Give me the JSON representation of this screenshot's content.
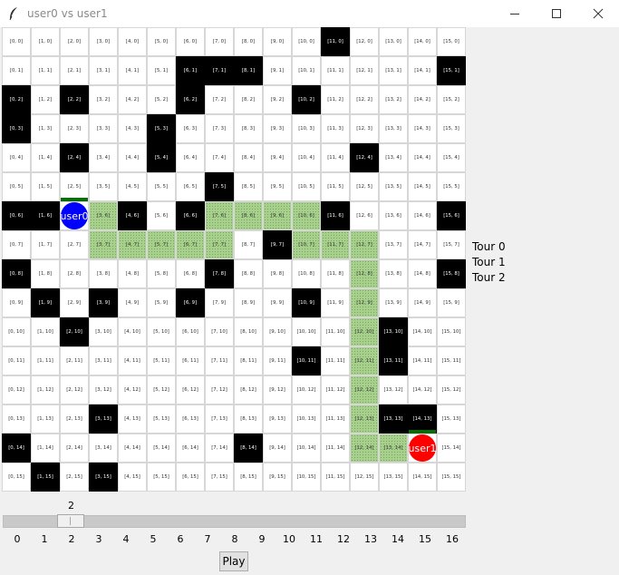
{
  "window": {
    "title": "user0 vs user1",
    "app_icon": "feather-icon"
  },
  "board": {
    "size": 16,
    "walls": [
      [
        11,
        0
      ],
      [
        6,
        1
      ],
      [
        7,
        1
      ],
      [
        8,
        1
      ],
      [
        15,
        1
      ],
      [
        0,
        2
      ],
      [
        2,
        2
      ],
      [
        6,
        2
      ],
      [
        10,
        2
      ],
      [
        0,
        3
      ],
      [
        5,
        3
      ],
      [
        2,
        4
      ],
      [
        5,
        4
      ],
      [
        12,
        4
      ],
      [
        7,
        5
      ],
      [
        0,
        6
      ],
      [
        1,
        6
      ],
      [
        4,
        6
      ],
      [
        6,
        6
      ],
      [
        11,
        6
      ],
      [
        15,
        6
      ],
      [
        9,
        7
      ],
      [
        0,
        8
      ],
      [
        7,
        8
      ],
      [
        15,
        8
      ],
      [
        1,
        9
      ],
      [
        3,
        9
      ],
      [
        6,
        9
      ],
      [
        10,
        9
      ],
      [
        2,
        10
      ],
      [
        13,
        10
      ],
      [
        10,
        11
      ],
      [
        13,
        11
      ],
      [
        3,
        13
      ],
      [
        13,
        13
      ],
      [
        14,
        13
      ],
      [
        0,
        14
      ],
      [
        8,
        14
      ],
      [
        1,
        15
      ],
      [
        3,
        15
      ]
    ],
    "path": [
      [
        3,
        6
      ],
      [
        7,
        6
      ],
      [
        8,
        6
      ],
      [
        9,
        6
      ],
      [
        10,
        6
      ],
      [
        3,
        7
      ],
      [
        4,
        7
      ],
      [
        5,
        7
      ],
      [
        6,
        7
      ],
      [
        7,
        7
      ],
      [
        10,
        7
      ],
      [
        11,
        7
      ],
      [
        12,
        7
      ],
      [
        12,
        8
      ],
      [
        12,
        9
      ],
      [
        12,
        10
      ],
      [
        12,
        11
      ],
      [
        12,
        12
      ],
      [
        12,
        13
      ],
      [
        12,
        14
      ],
      [
        13,
        14
      ]
    ],
    "colors": {
      "wall": "#000000",
      "path": "#a8d08d",
      "user0": "#0000ff",
      "user1": "#ff0000",
      "health": "#0a6b0a"
    }
  },
  "players": [
    {
      "name": "user0",
      "x": 2,
      "y": 6,
      "color": "#0000ff"
    },
    {
      "name": "user1",
      "x": 14,
      "y": 14,
      "color": "#ff0000"
    }
  ],
  "turns": [
    "Tour 0",
    "Tour 1",
    "Tour 2"
  ],
  "slider": {
    "value": "2",
    "min": 0,
    "max": 16,
    "ticks": [
      "0",
      "1",
      "2",
      "3",
      "4",
      "5",
      "6",
      "7",
      "8",
      "9",
      "10",
      "11",
      "12",
      "13",
      "14",
      "15",
      "16"
    ]
  },
  "play_label": "Play"
}
